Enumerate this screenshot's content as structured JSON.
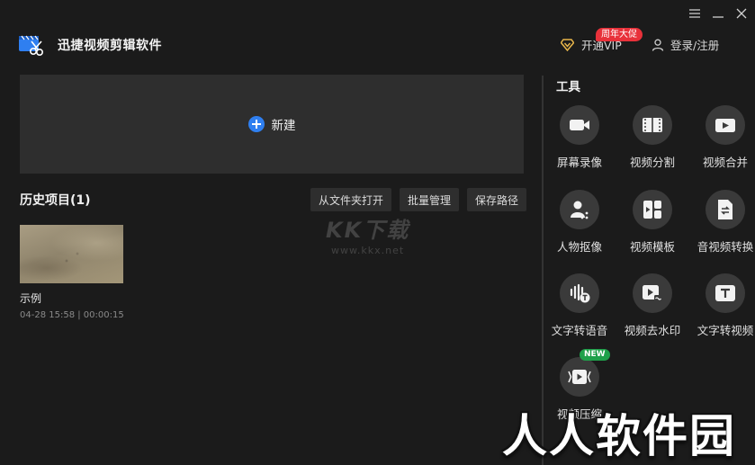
{
  "app": {
    "title": "迅捷视频剪辑软件"
  },
  "header": {
    "vip_label": "开通VIP",
    "promo_badge": "周年大促",
    "login_label": "登录/注册"
  },
  "main": {
    "new_label": "新建",
    "history": {
      "title": "历史项目(1)",
      "actions": [
        "从文件夹打开",
        "批量管理",
        "保存路径"
      ],
      "projects": [
        {
          "name": "示例",
          "date": "04-28 15:58",
          "duration": "00:00:15",
          "meta": "04-28 15:58 | 00:00:15"
        }
      ]
    }
  },
  "tools": {
    "title": "工具",
    "items": [
      {
        "label": "屏幕录像",
        "icon": "camera-icon"
      },
      {
        "label": "视频分割",
        "icon": "film-split-icon"
      },
      {
        "label": "视频合并",
        "icon": "video-merge-icon"
      },
      {
        "label": "人物抠像",
        "icon": "person-cutout-icon"
      },
      {
        "label": "视频模板",
        "icon": "template-icon"
      },
      {
        "label": "音视频转换",
        "icon": "convert-icon"
      },
      {
        "label": "文字转语音",
        "icon": "text-to-speech-icon"
      },
      {
        "label": "视频去水印",
        "icon": "remove-watermark-icon"
      },
      {
        "label": "文字转视频",
        "icon": "text-to-video-icon"
      },
      {
        "label": "视频压缩",
        "icon": "compress-icon",
        "badge": "NEW"
      }
    ]
  },
  "watermarks": {
    "center_kk": "KK下载",
    "center_url": "www.kkx.net",
    "bottom": "人人软件园"
  },
  "colors": {
    "accent": "#2f7ff0",
    "promo": "#e8313a",
    "new_badge": "#1fa04a",
    "vip_gold": "#e7b54a"
  }
}
